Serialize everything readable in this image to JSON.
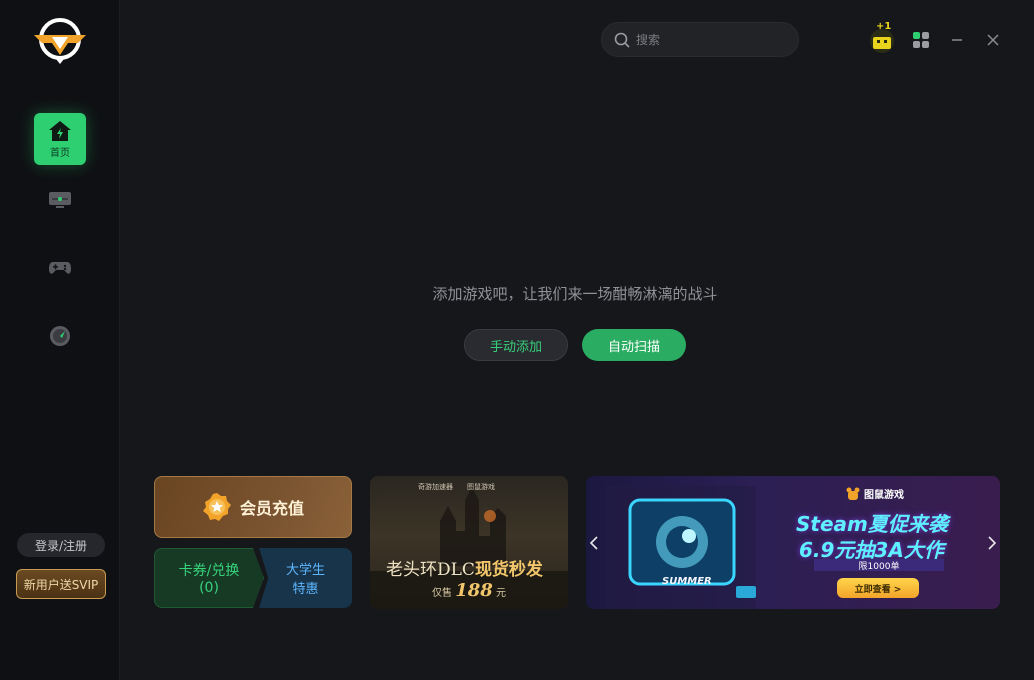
{
  "sidebar": {
    "nav_home_label": "首页",
    "login_label": "登录/注册",
    "svip_label": "新用户送SVIP"
  },
  "topbar": {
    "search_placeholder": "搜索",
    "gift_badge": "+1"
  },
  "main": {
    "empty_text": "添加游戏吧，让我们来一场酣畅淋漓的战斗",
    "manual_add_label": "手动添加",
    "auto_scan_label": "自动扫描"
  },
  "cards": {
    "vip_title": "会员充值",
    "coupon_line1": "卡券/兑换",
    "coupon_count": "(0)",
    "student_line1": "大学生",
    "student_line2": "特惠"
  },
  "banner1": {
    "brand_left": "奇游加速器",
    "brand_right": "图鼠游戏",
    "headline_a": "老头环DLC",
    "headline_b": "现货秒发",
    "price_prefix": "仅售",
    "price": "188",
    "price_suffix": "元"
  },
  "banner2": {
    "brand": "图鼠游戏",
    "line1": "Steam夏促来袭",
    "line2": "6.9元抽3A大作",
    "limit": "限1000单",
    "cta": "立即查看 >",
    "summer": "SUMMER"
  },
  "colors": {
    "accent": "#2ecf71",
    "gold": "#c99a52"
  }
}
